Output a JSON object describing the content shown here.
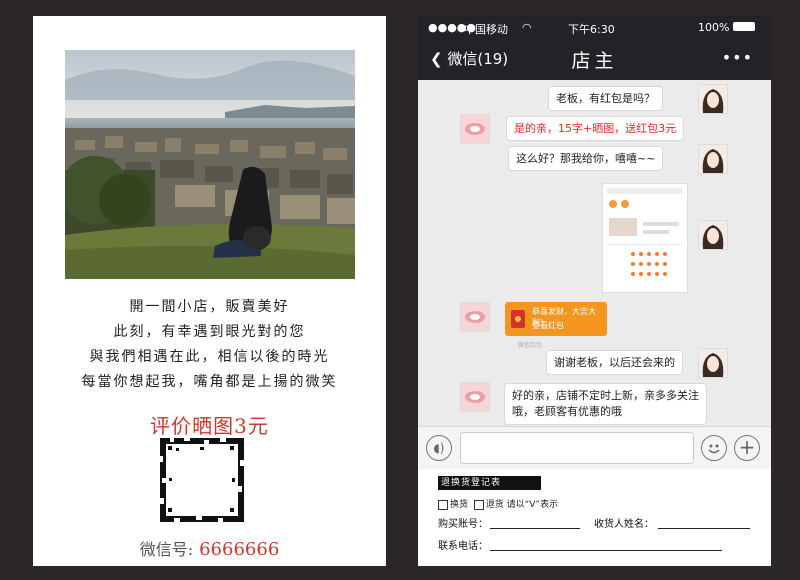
{
  "poster": {
    "poem_lines": [
      "開一間小店，販賣美好",
      "此刻，有幸遇到眼光對的您",
      "與我們相遇在此，相信以後的時光",
      "每當你想起我，嘴角都是上揚的微笑"
    ],
    "promo": "评价晒图3元",
    "wechat_label": "微信号:",
    "wechat_id": "6666666"
  },
  "phone": {
    "carrier": "中国移动",
    "time": "下午6:30",
    "battery": "100%",
    "back_label": "微信(19)",
    "chat_title": "店主",
    "messages": [
      {
        "side": "right",
        "text": "老板，有红包是吗？"
      },
      {
        "side": "left",
        "text": "是的亲，15字+晒图，送红包3元",
        "highlight": true
      },
      {
        "side": "right",
        "text": "这么好？那我给你，嘻嘻~~"
      },
      {
        "side": "left",
        "text": "好的亲，店铺不定时上新，亲多多关注"
      },
      {
        "side": "left",
        "text": "哦，老顾客有优惠的哦"
      },
      {
        "side": "right",
        "text": "谢谢老板，以后还会来的"
      }
    ],
    "red_packet": {
      "line1": "恭喜发财，大吉大利！",
      "line2": "查看红包",
      "caption": "微信红包"
    }
  },
  "form": {
    "title": "退换货登记表",
    "option_exchange": "换货",
    "option_return": "退货 请以“V”表示",
    "account_label": "购买账号：",
    "recipient_label": "收货人姓名：",
    "phone_label": "联系电话："
  },
  "colors": {
    "background": "#2b2627",
    "accent_red": "#d2352b",
    "dark_bar": "#222326",
    "chat_bg": "#ebebeb",
    "red_packet": "#f3961f"
  }
}
